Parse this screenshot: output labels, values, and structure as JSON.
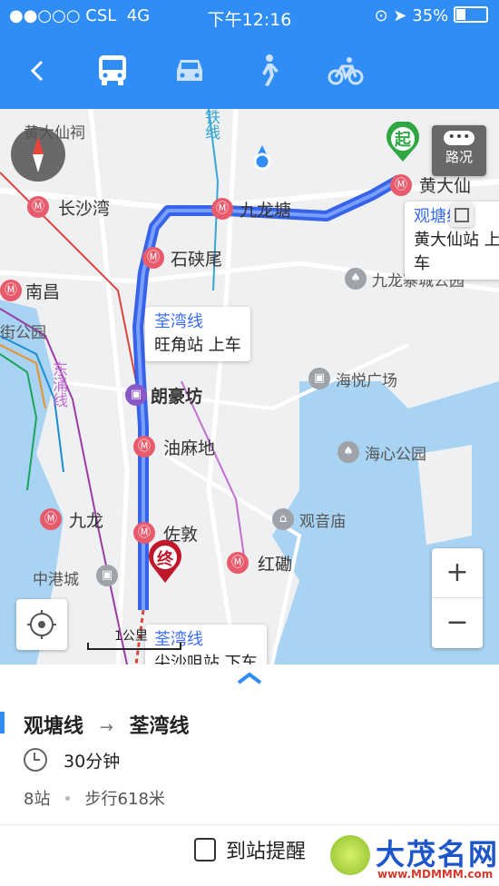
{
  "status": {
    "carrier": "●●○○○ CSL",
    "network": "4G",
    "time": "下午12:16",
    "battery": "35%"
  },
  "nav": {
    "modes": [
      "bus-icon",
      "car-icon",
      "walk-icon",
      "bike-icon"
    ]
  },
  "map": {
    "stations": {
      "wongtaisin": "黄大仙",
      "lokfu": "长沙湾",
      "kowloontong": "九龙塘",
      "shekkipmei": "石硖尾",
      "namcheong": "南昌",
      "yaumatei": "油麻地",
      "jordan": "佐敦",
      "kowloon": "九龙",
      "hunghom": "红磡",
      "wongtaisintemple": "黄大仙祠"
    },
    "pois": {
      "langham": "朗豪坊",
      "kowlooncity_park": "九龙寨城公园",
      "hoi_yuet": "海悦广场",
      "hoi_sum": "海心公园",
      "kwun_yam": "观音庙",
      "china_ferry": "中港城",
      "east_rail": "东涌线",
      "kwai": "街公园",
      "rail_line": "铁线"
    },
    "start_badge": "起",
    "end_badge": "终",
    "traffic_label": "路况",
    "callout_start_line": "观塘线",
    "callout_start_stop": "黄大仙站 上车",
    "callout_transfer_line": "荃湾线",
    "callout_transfer_stop": "旺角站 上车",
    "callout_end_line": "荃湾线",
    "callout_end_stop": "尖沙咀站 下车",
    "scale": "1公里",
    "zoom_in": "+",
    "zoom_out": "−"
  },
  "route": {
    "from_line": "观塘线",
    "arrow": "→",
    "to_line": "荃湾线",
    "duration": "30分钟",
    "stops": "8站",
    "walk": "步行618米",
    "remind_button": "到站提醒"
  },
  "watermark": {
    "brand": "大茂名网",
    "url": "www.MDMMM.com"
  },
  "colors": {
    "primary": "#2f8df5",
    "route": "#3a6df0",
    "mtr": "#e85b6d"
  }
}
